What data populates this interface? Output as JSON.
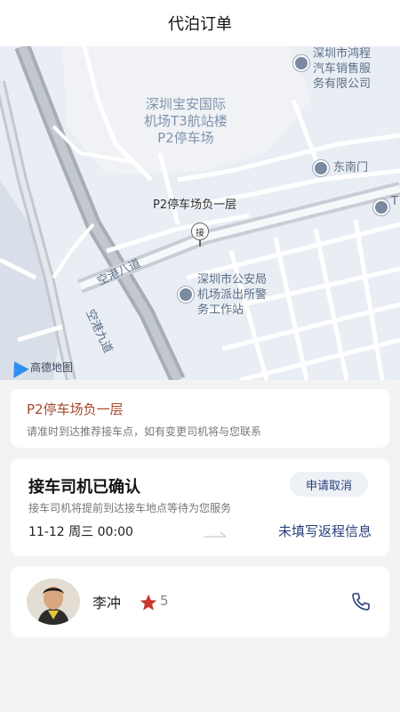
{
  "header": {
    "title": "代泊订单"
  },
  "map": {
    "labels": {
      "dealer": "深圳市鸿程\n汽车销售服\n务有限公司",
      "terminal": "深圳宝安国际\n机场T3航站楼\nP2停车场",
      "southeast_gate": "东南门",
      "edge_t": "T",
      "pin_char": "接",
      "pickup": "P2停车场负一层",
      "road1": "空港八道",
      "road2": "空港九道",
      "police": "深圳市公安局\n机场派出所警\n务工作站"
    },
    "logo": "高德地图"
  },
  "location_card": {
    "name": "P2停车场负一层",
    "hint": "请准时到达推荐接车点，如有变更司机将与您联系"
  },
  "status_card": {
    "status": "接车司机已确认",
    "cancel_label": "申请取消",
    "subtitle": "接车司机将提前到达接车地点等待为您服务",
    "time": "11-12 周三 00:00",
    "return_info": "未填写返程信息"
  },
  "driver_card": {
    "name": "李冲",
    "rating": "5",
    "icons": {
      "star": "star-icon",
      "phone": "phone-icon"
    }
  },
  "colors": {
    "accent": "#2a3f7a",
    "location": "#a8472a",
    "star": "#c8372d"
  }
}
